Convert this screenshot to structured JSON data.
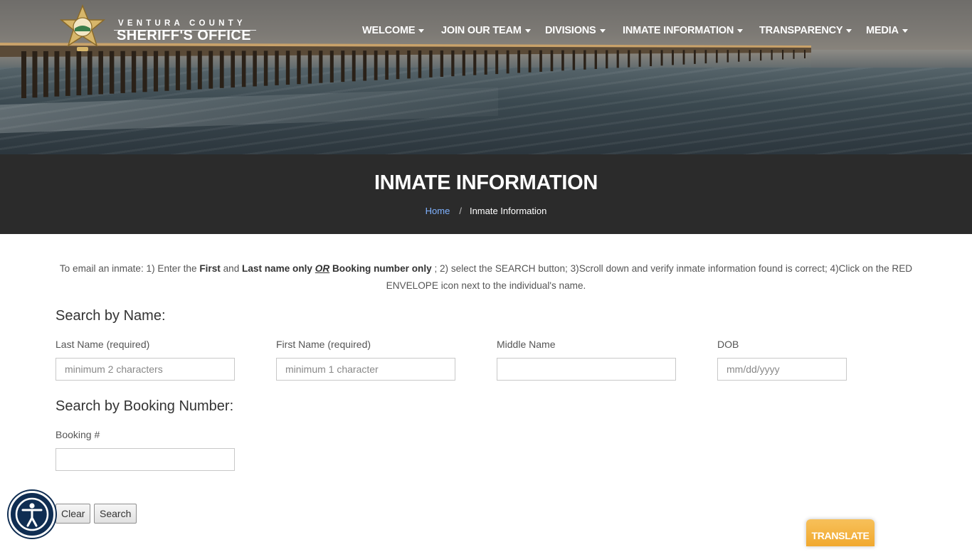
{
  "header": {
    "logo_top": "VENTURA COUNTY",
    "logo_main": "SHERIFF'S OFFICE",
    "nav": [
      {
        "label": "WELCOME"
      },
      {
        "label": "JOIN OUR TEAM"
      },
      {
        "label": "DIVISIONS"
      },
      {
        "label": "INMATE INFORMATION"
      },
      {
        "label": "TRANSPARENCY"
      },
      {
        "label": "MEDIA"
      }
    ]
  },
  "page": {
    "title": "INMATE INFORMATION",
    "breadcrumb": {
      "home": "Home",
      "separator": "/",
      "current": "Inmate Information"
    }
  },
  "instructions": {
    "p1": "To email an inmate: 1) Enter the ",
    "first": "First",
    "and": " and ",
    "last_only": "Last name only",
    "or": "OR",
    "booking_only": "Booking number only",
    "p2": " ; 2) select the SEARCH button;  3)Scroll down and verify inmate information found is correct; 4)Click on the RED ENVELOPE icon next to the individual's name."
  },
  "search_by_name": {
    "heading": "Search by Name:",
    "last_name": {
      "label": "Last Name (required)",
      "placeholder": "minimum 2 characters",
      "value": ""
    },
    "first_name": {
      "label": "First Name (required)",
      "placeholder": "minimum 1 character",
      "value": ""
    },
    "middle_name": {
      "label": "Middle Name",
      "placeholder": "",
      "value": ""
    },
    "dob": {
      "label": "DOB",
      "placeholder": "mm/dd/yyyy",
      "value": ""
    }
  },
  "search_by_booking": {
    "heading": "Search by Booking Number:",
    "booking": {
      "label": "Booking #",
      "placeholder": "",
      "value": ""
    }
  },
  "buttons": {
    "clear": "Clear",
    "search": "Search"
  },
  "widgets": {
    "translate": "TRANSLATE",
    "accessibility_icon": "accessibility-icon"
  },
  "colors": {
    "band": "#2b2b2b",
    "link": "#7fb2ff",
    "translate": "#f1a92f",
    "accessibility": "#0f2d52"
  }
}
